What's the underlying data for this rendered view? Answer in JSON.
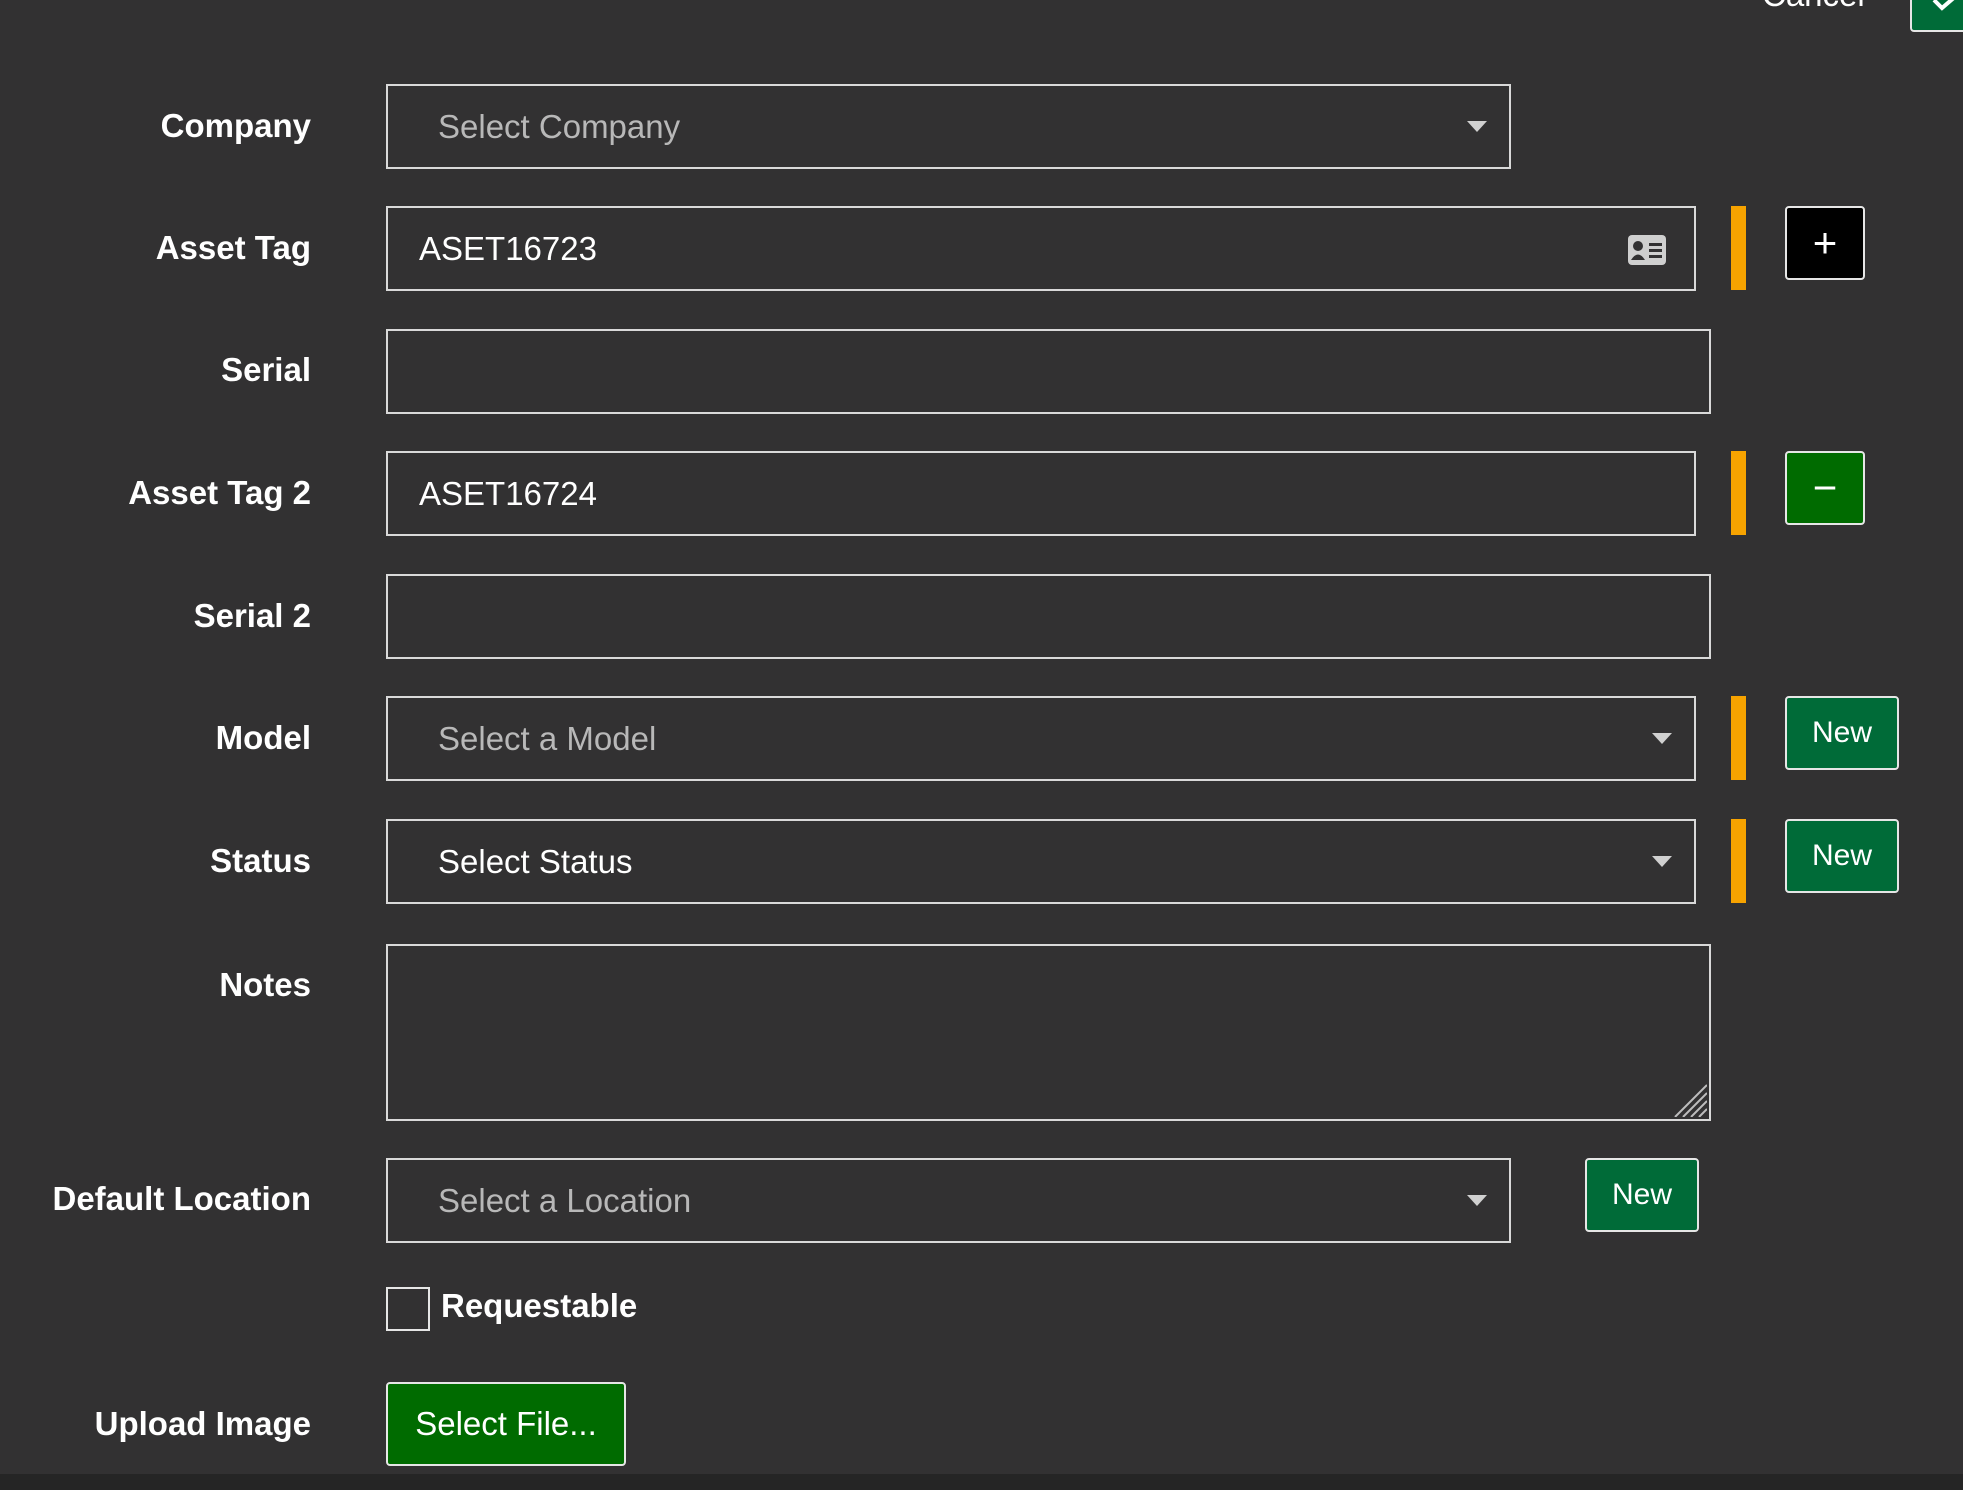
{
  "header": {
    "cancel_label": "Cancel"
  },
  "form": {
    "company": {
      "label": "Company",
      "placeholder": "Select Company"
    },
    "asset_tag": {
      "label": "Asset Tag",
      "value": "ASET16723",
      "icon": "id-card-icon"
    },
    "serial": {
      "label": "Serial",
      "value": ""
    },
    "asset_tag_2": {
      "label": "Asset Tag 2",
      "value": "ASET16724"
    },
    "serial_2": {
      "label": "Serial 2",
      "value": ""
    },
    "model": {
      "label": "Model",
      "placeholder": "Select a Model",
      "new_label": "New"
    },
    "status": {
      "label": "Status",
      "selected": "Select Status",
      "new_label": "New"
    },
    "notes": {
      "label": "Notes",
      "value": ""
    },
    "default_location": {
      "label": "Default Location",
      "placeholder": "Select a Location",
      "new_label": "New"
    },
    "requestable": {
      "label": "Requestable",
      "checked": false
    },
    "upload_image": {
      "label": "Upload Image",
      "button_label": "Select File..."
    },
    "add_tag_symbol": "+",
    "remove_tag_symbol": "−"
  },
  "colors": {
    "background": "#323132",
    "required_bar": "#f7a300",
    "green_button": "#006b38",
    "upload_button": "#006b00"
  }
}
